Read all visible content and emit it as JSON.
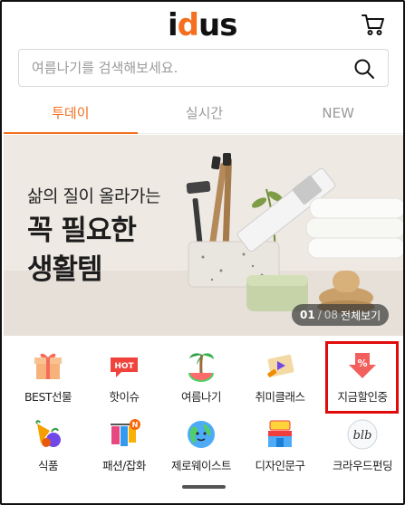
{
  "header": {
    "logo_parts": [
      "i",
      "d",
      "us"
    ],
    "icons": {
      "cart": "cart-icon",
      "search": "search-icon"
    }
  },
  "search": {
    "placeholder": "여름나기를 검색해보세요."
  },
  "tabs": [
    {
      "label": "투데이",
      "active": true
    },
    {
      "label": "실시간",
      "active": false
    },
    {
      "label": "NEW",
      "active": false
    }
  ],
  "banner": {
    "subtitle": "삶의 질이 올라가는",
    "title": "꼭 필요한\n생활템",
    "pager": {
      "current": "01",
      "separator": "/",
      "total": "08",
      "view_all": "전체보기"
    }
  },
  "categories": [
    {
      "label": "BEST선물",
      "icon": "gift-icon"
    },
    {
      "label": "핫이슈",
      "icon": "hot-badge-icon"
    },
    {
      "label": "여름나기",
      "icon": "watermelon-palm-icon"
    },
    {
      "label": "취미클래스",
      "icon": "video-class-icon"
    },
    {
      "label": "지금할인중",
      "icon": "discount-arrow-icon"
    },
    {
      "label": "식품",
      "icon": "food-icon"
    },
    {
      "label": "패션/잡화",
      "icon": "fashion-rack-icon"
    },
    {
      "label": "제로웨이스트",
      "icon": "earth-icon"
    },
    {
      "label": "디자인문구",
      "icon": "stationery-shop-icon"
    },
    {
      "label": "크라우드펀딩",
      "icon": "funding-icon"
    }
  ],
  "colors": {
    "accent": "#f56f1f",
    "highlight": "#e20b0b",
    "banner_bg": "#eee9e3"
  }
}
